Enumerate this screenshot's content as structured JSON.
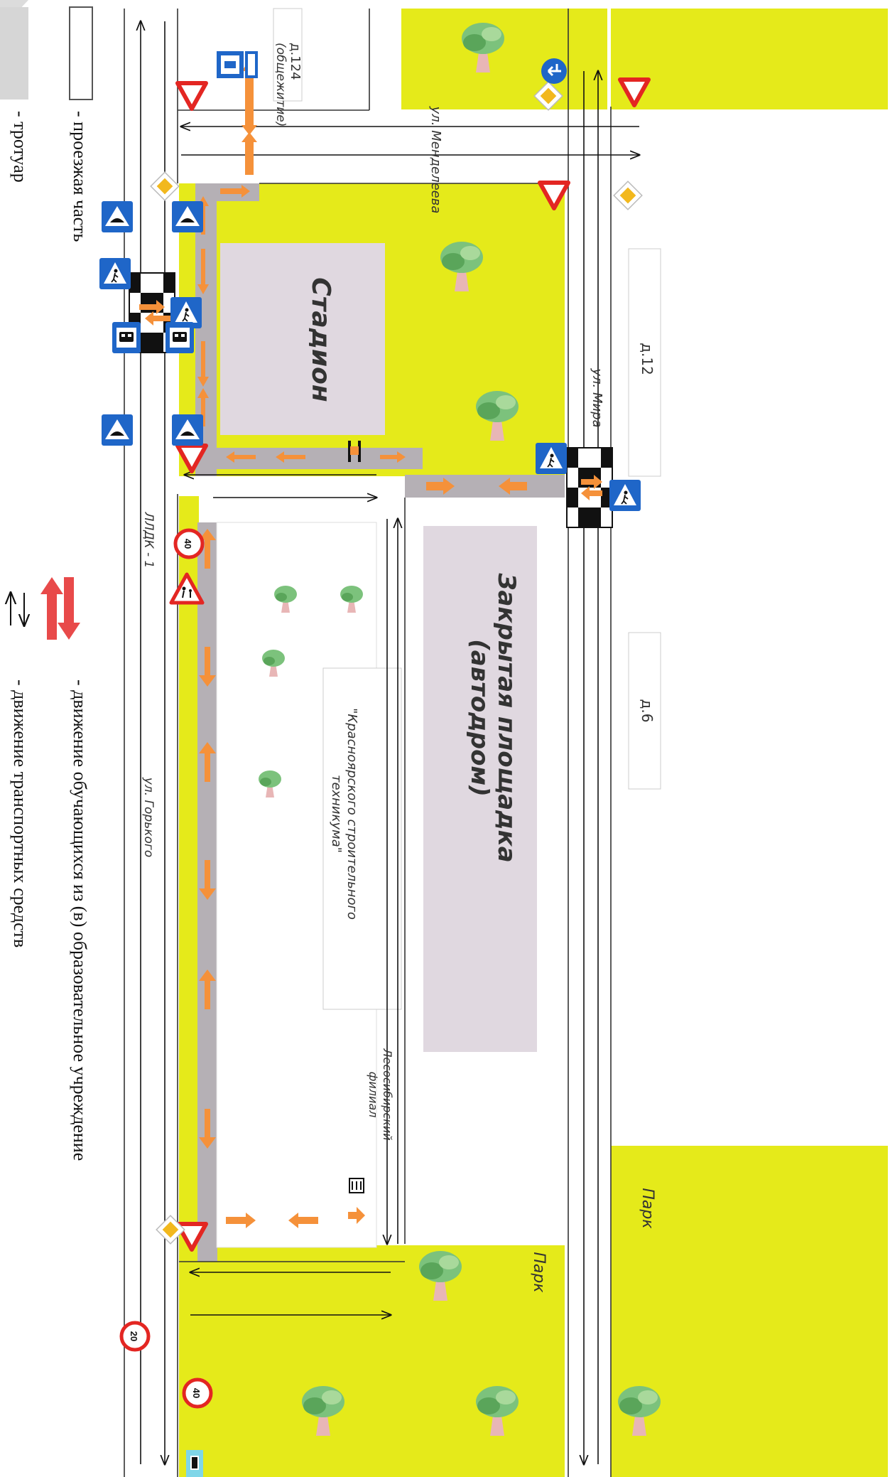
{
  "map": {
    "buildings": {
      "stadium": "Стадион",
      "autodrome_line1": "Закрытая площадка",
      "autodrome_line2": "(автодром)",
      "house_12": "д.12",
      "house_6": "д.6",
      "house_124": "д.124",
      "dormitory": "(общежитие)",
      "branch_line1": "Лесосибирский",
      "branch_line2": "филиал",
      "technikum_line1": "\"Красноярского строительного",
      "technikum_line2": "техникума\""
    },
    "streets": {
      "mendeleeva": "ул. Менделеева",
      "mira": "ул. Мира",
      "gorkogo": "ул. Горького",
      "lldk": "ЛЛДК - 1"
    },
    "parks": {
      "park_top": "Парк",
      "park_inner": "Парк"
    },
    "signs": {
      "speed_limit_top": "40",
      "speed_limit_bottom": "40",
      "no_entry_limit": "20"
    }
  },
  "legend": {
    "roadway": "- проезжая часть",
    "sidewalk": "- тротуар",
    "student_movement": "- движение обучающихся из (в) образовательное  учреждение",
    "vehicle_movement": "- движение транспортных средств"
  },
  "colors": {
    "grass": "#e5ea1a",
    "sidewalk": "#b5b0b5",
    "building": "#e0d8e0",
    "student_arrow": "#f5913a",
    "legend_arrow": "#e84a4a",
    "sign_blue": "#1f66c8",
    "sign_red": "#e32622"
  }
}
